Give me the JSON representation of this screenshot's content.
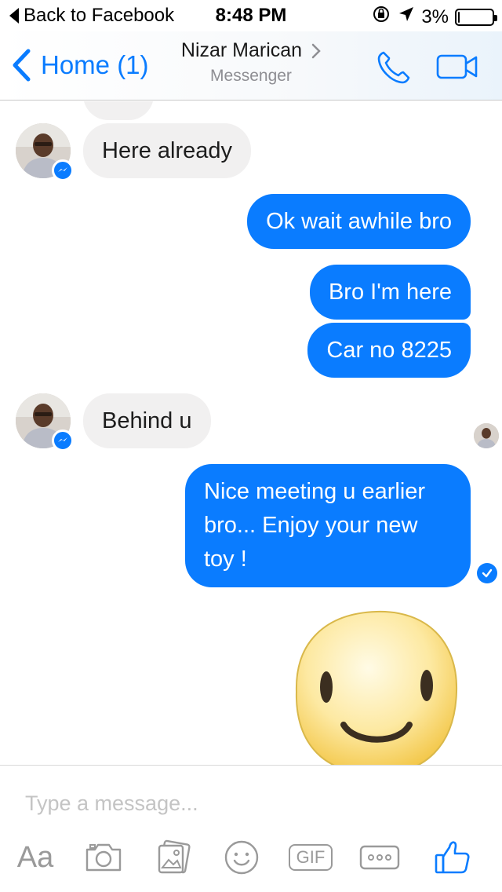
{
  "status_bar": {
    "back_label": "Back to Facebook",
    "time": "8:48 PM",
    "battery": "3%",
    "battery_level": 0.03,
    "icons": [
      "orientation-lock-icon",
      "location-arrow-icon",
      "battery-icon"
    ]
  },
  "nav": {
    "back_label": "Home (1)",
    "title": "Nizar Marican",
    "subtitle": "Messenger",
    "accent_color": "#0a7cff",
    "icons": [
      "chevron-left-icon",
      "chevron-right-icon",
      "phone-icon",
      "video-camera-icon"
    ]
  },
  "messages": [
    {
      "direction": "incoming",
      "text": "Here already"
    },
    {
      "direction": "outgoing",
      "text": "Ok wait awhile bro"
    },
    {
      "direction": "outgoing",
      "text": "Bro I'm here"
    },
    {
      "direction": "outgoing",
      "text": "Car no 8225"
    },
    {
      "direction": "incoming",
      "text": "Behind u"
    },
    {
      "direction": "outgoing",
      "text": "Nice meeting u earlier bro... Enjoy your new toy !"
    }
  ],
  "colors": {
    "outgoing_bubble": "#0a7cff",
    "incoming_bubble": "#f1f0f0"
  },
  "composer": {
    "placeholder": "Type a message...",
    "aa_label": "Aa",
    "gif_label": "GIF",
    "icons": [
      "text-format-icon",
      "camera-icon",
      "photo-gallery-icon",
      "emoji-icon",
      "gif-icon",
      "more-icon",
      "like-thumb-icon"
    ]
  }
}
